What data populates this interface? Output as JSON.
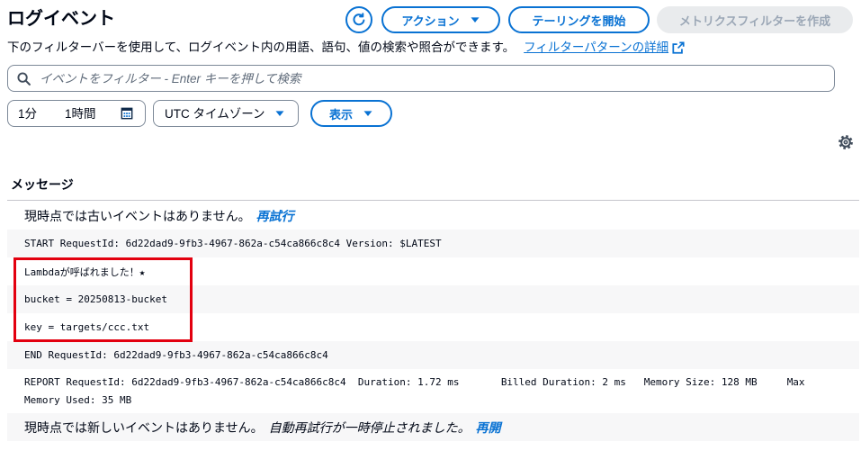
{
  "header": {
    "title": "ログイベント",
    "actions_label": "アクション",
    "tailing_label": "テーリングを開始",
    "create_metric_filter_label": "メトリクスフィルターを作成"
  },
  "description": {
    "text": "下のフィルターバーを使用して、ログイベント内の用語、語句、値の検索や照合ができます。",
    "link_label": "フィルターパターンの詳細"
  },
  "filter": {
    "placeholder": "イベントをフィルター - Enter キーを押して検索"
  },
  "time_range": {
    "options": [
      "1分",
      "1時間"
    ]
  },
  "timezone": {
    "selected": "UTC タイムゾーン"
  },
  "display": {
    "label": "表示"
  },
  "table": {
    "column_header": "メッセージ",
    "older_status": {
      "text": "現時点では古いイベントはありません。",
      "retry_label": "再試行"
    },
    "log_lines": [
      "START RequestId: 6d22dad9-9fb3-4967-862a-c54ca866c8c4 Version: $LATEST",
      "Lambdaが呼ばれました！★",
      "bucket = 20250813-bucket",
      "key = targets/ccc.txt",
      "END RequestId: 6d22dad9-9fb3-4967-862a-c54ca866c8c4",
      "REPORT RequestId: 6d22dad9-9fb3-4967-862a-c54ca866c8c4\tDuration: 1.72 ms\tBilled Duration: 2 ms\tMemory Size: 128 MB\tMax Memory Used: 35 MB\t"
    ],
    "newer_status": {
      "text": "現時点では新しいイベントはありません。",
      "paused_text": "自動再試行が一時停止されました。",
      "resume_label": "再開"
    }
  },
  "icons": {
    "refresh": "refresh-icon",
    "dropdown": "caret-down-icon",
    "external_link": "external-link-icon",
    "search": "search-icon",
    "calendar": "calendar-icon",
    "settings": "settings-icon"
  },
  "colors": {
    "accent": "#0972d3",
    "text": "#000716",
    "disabled_bg": "#e9ebed",
    "disabled_text": "#9ba7b6",
    "highlight": "#e3000f"
  }
}
